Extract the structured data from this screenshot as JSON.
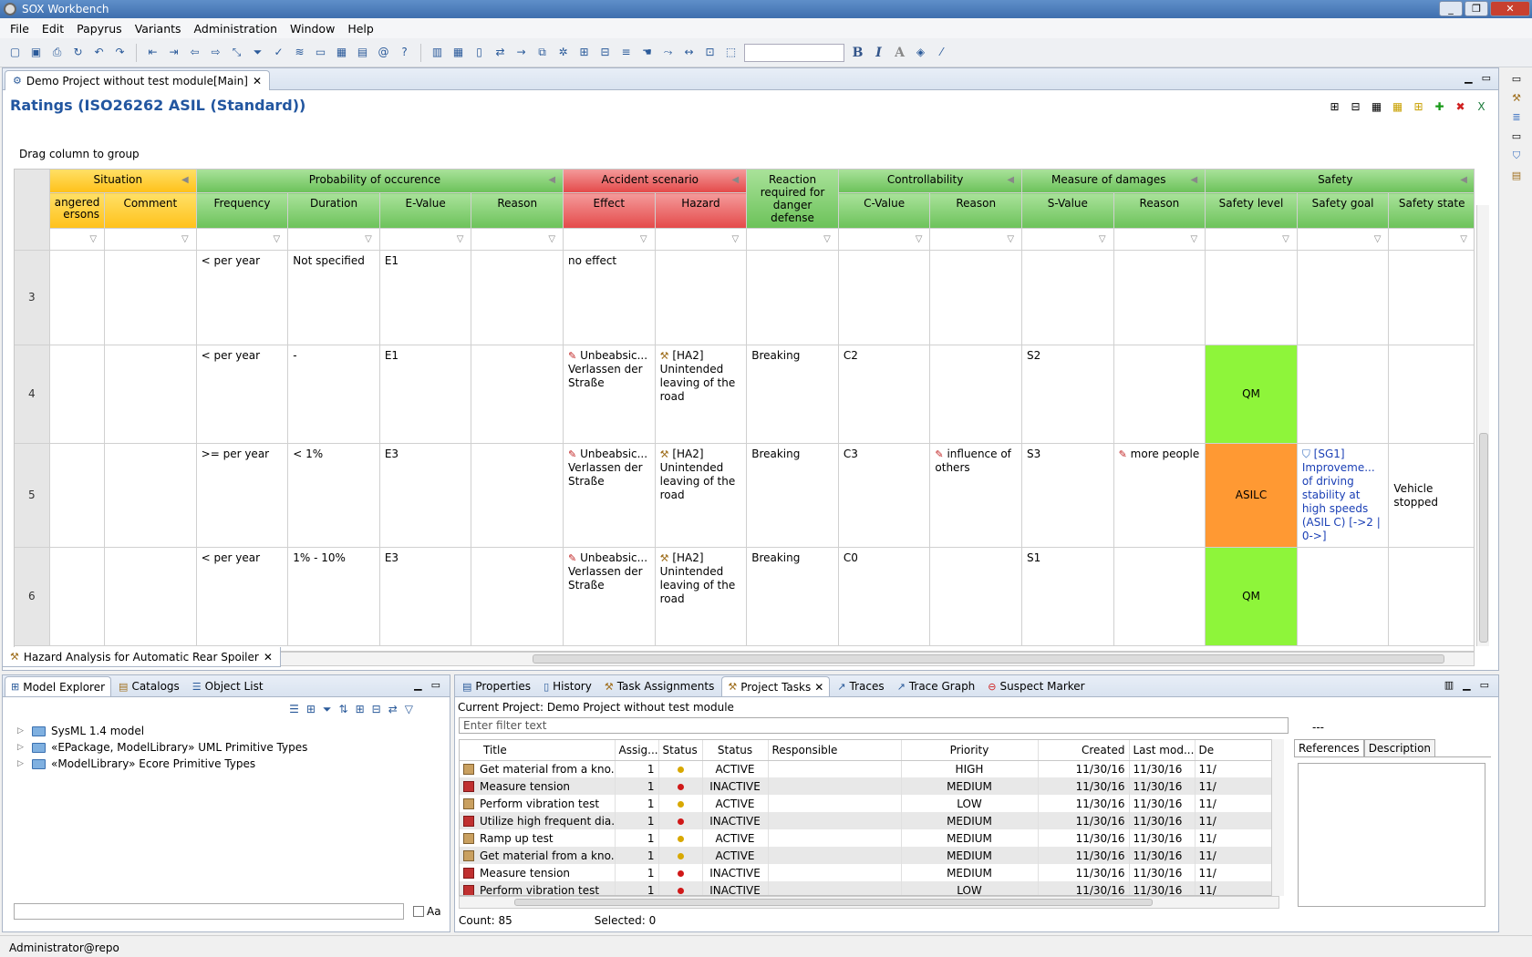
{
  "window": {
    "title": "SOX Workbench",
    "controls": [
      "_",
      "❐",
      "✕"
    ]
  },
  "menu": [
    "File",
    "Edit",
    "Papyrus",
    "Variants",
    "Administration",
    "Window",
    "Help"
  ],
  "toolbar": {
    "bold": "B",
    "italic": "I",
    "font_a": "A"
  },
  "editor": {
    "tab_label": "Demo Project without test module[Main]",
    "title": "Ratings (ISO26262 ASIL (Standard))",
    "drag_hint": "Drag column to group",
    "bottom_tab": "Hazard Analysis for Automatic Rear Spoiler"
  },
  "grid": {
    "groups": [
      "Situation",
      "Probability of occurence",
      "Accident scenario",
      "Reaction required for danger defense",
      "Controllability",
      "Measure of damages",
      "Safety"
    ],
    "columns": [
      "angered ersons",
      "Comment",
      "Frequency",
      "Duration",
      "E-Value",
      "Reason",
      "Effect",
      "Hazard",
      "",
      "C-Value",
      "Reason",
      "S-Value",
      "Reason",
      "Safety level",
      "Safety goal",
      "Safety state"
    ],
    "rows": [
      {
        "n": "3",
        "freq": "< per year",
        "dur": "Not specified",
        "e": "E1",
        "effect": "no effect",
        "hazard": "",
        "react": "",
        "c": "",
        "creason": "",
        "s": "",
        "sreason": "",
        "level": "",
        "goal": "",
        "state": ""
      },
      {
        "n": "4",
        "freq": "< per year",
        "dur": "-",
        "e": "E1",
        "effect": "Unbeabsic... Verlassen der Straße",
        "hazard": "[HA2] Unintended leaving of the road",
        "react": "Breaking",
        "c": "C2",
        "creason": "",
        "s": "S2",
        "sreason": "",
        "level": "QM",
        "goal": "",
        "state": ""
      },
      {
        "n": "5",
        "freq": ">= per year",
        "dur": "< 1%",
        "e": "E3",
        "effect": "Unbeabsic... Verlassen der Straße",
        "hazard": "[HA2] Unintended leaving of the road",
        "react": "Breaking",
        "c": "C3",
        "creason": "influence of others",
        "s": "S3",
        "sreason": "more people",
        "level": "ASILC",
        "goal": "[SG1] Improveme... of driving stability at high speeds (ASIL C) [->2 | 0->]",
        "state": "Vehicle stopped"
      },
      {
        "n": "6",
        "freq": "< per year",
        "dur": "1% - 10%",
        "e": "E3",
        "effect": "Unbeabsic... Verlassen der Straße",
        "hazard": "[HA2] Unintended leaving of the road",
        "react": "Breaking",
        "c": "C0",
        "creason": "",
        "s": "S1",
        "sreason": "",
        "level": "QM",
        "goal": "",
        "state": ""
      }
    ]
  },
  "left_pane": {
    "tabs": [
      "Model Explorer",
      "Catalogs",
      "Object List"
    ],
    "tree": [
      "SysML 1.4 model",
      "«EPackage, ModelLibrary» UML Primitive Types",
      "«ModelLibrary» Ecore Primitive Types"
    ],
    "case_label": "Aa"
  },
  "right_pane": {
    "tabs": [
      "Properties",
      "History",
      "Task Assignments",
      "Project Tasks",
      "Traces",
      "Trace Graph",
      "Suspect Marker"
    ],
    "current_project_label": "Current Project:",
    "current_project": "Demo Project without test module",
    "filter_placeholder": "Enter filter text",
    "dash": "---",
    "headers": [
      "Title",
      "Assig...",
      "Status",
      "Status",
      "Responsible",
      "Priority",
      "Created",
      "Last mod...",
      "De"
    ],
    "rows": [
      {
        "title": "Get material from a kno...",
        "assign": "1",
        "dot": "y",
        "status": "ACTIVE",
        "resp": "",
        "prio": "HIGH",
        "created": "11/30/16",
        "mod": "11/30/16",
        "de": "11/",
        "icon": "task"
      },
      {
        "title": "Measure tension",
        "assign": "1",
        "dot": "r",
        "status": "INACTIVE",
        "resp": "",
        "prio": "MEDIUM",
        "created": "11/30/16",
        "mod": "11/30/16",
        "de": "11/",
        "icon": "red"
      },
      {
        "title": "Perform vibration test",
        "assign": "1",
        "dot": "y",
        "status": "ACTIVE",
        "resp": "",
        "prio": "LOW",
        "created": "11/30/16",
        "mod": "11/30/16",
        "de": "11/",
        "icon": "task"
      },
      {
        "title": "Utilize high frequent dia...",
        "assign": "1",
        "dot": "r",
        "status": "INACTIVE",
        "resp": "",
        "prio": "MEDIUM",
        "created": "11/30/16",
        "mod": "11/30/16",
        "de": "11/",
        "icon": "red"
      },
      {
        "title": "Ramp up test",
        "assign": "1",
        "dot": "y",
        "status": "ACTIVE",
        "resp": "",
        "prio": "MEDIUM",
        "created": "11/30/16",
        "mod": "11/30/16",
        "de": "11/",
        "icon": "task"
      },
      {
        "title": "Get material from a kno...",
        "assign": "1",
        "dot": "y",
        "status": "ACTIVE",
        "resp": "",
        "prio": "MEDIUM",
        "created": "11/30/16",
        "mod": "11/30/16",
        "de": "11/",
        "icon": "task"
      },
      {
        "title": "Measure tension",
        "assign": "1",
        "dot": "r",
        "status": "INACTIVE",
        "resp": "",
        "prio": "MEDIUM",
        "created": "11/30/16",
        "mod": "11/30/16",
        "de": "11/",
        "icon": "red"
      },
      {
        "title": "Perform vibration test",
        "assign": "1",
        "dot": "r",
        "status": "INACTIVE",
        "resp": "",
        "prio": "LOW",
        "created": "11/30/16",
        "mod": "11/30/16",
        "de": "11/",
        "icon": "red"
      }
    ],
    "count": "Count: 85",
    "selected": "Selected: 0",
    "ref_tabs": [
      "References",
      "Description"
    ]
  },
  "status_bar": "Administrator@repo"
}
